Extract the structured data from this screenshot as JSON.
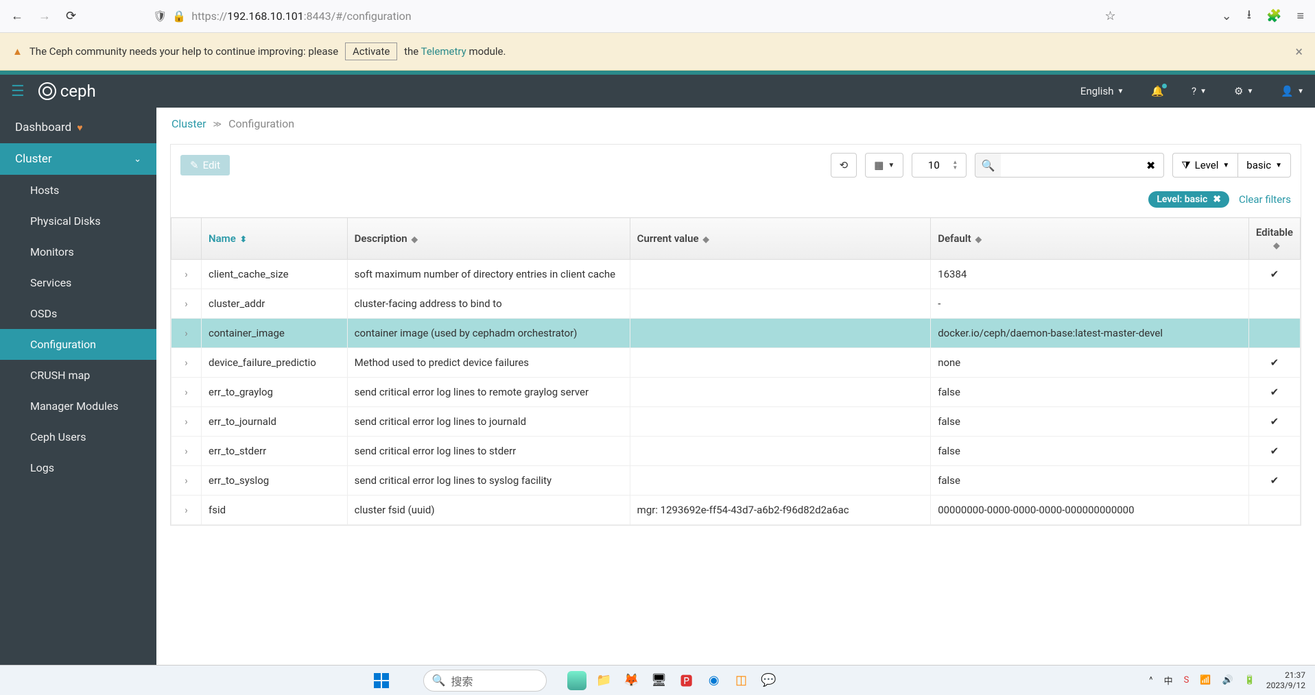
{
  "browser": {
    "url_scheme": "https://",
    "url_host": "192.168.10.101",
    "url_port": ":8443",
    "url_path": "/#/configuration"
  },
  "banner": {
    "text_before": "The Ceph community needs your help to continue improving: please",
    "activate": "Activate",
    "text_mid": "the",
    "telemetry": "Telemetry",
    "text_after": "module."
  },
  "topnav": {
    "brand": "ceph",
    "language": "English"
  },
  "sidebar": {
    "dashboard": "Dashboard",
    "cluster": "Cluster",
    "items": [
      "Hosts",
      "Physical Disks",
      "Monitors",
      "Services",
      "OSDs",
      "Configuration",
      "CRUSH map",
      "Manager Modules",
      "Ceph Users",
      "Logs"
    ]
  },
  "breadcrumb": {
    "root": "Cluster",
    "current": "Configuration"
  },
  "toolbar": {
    "edit": "Edit",
    "page_size": "10",
    "level_label": "Level",
    "level_value": "basic"
  },
  "filters": {
    "chip": "Level: basic",
    "clear": "Clear filters"
  },
  "table": {
    "headers": {
      "name": "Name",
      "description": "Description",
      "current_value": "Current value",
      "default": "Default",
      "editable": "Editable"
    },
    "rows": [
      {
        "name": "client_cache_size",
        "description": "soft maximum number of directory entries in client cache",
        "current": "",
        "default": "16384",
        "editable": true,
        "highlight": false
      },
      {
        "name": "cluster_addr",
        "description": "cluster-facing address to bind to",
        "current": "",
        "default": "-",
        "editable": false,
        "highlight": false
      },
      {
        "name": "container_image",
        "description": "container image (used by cephadm orchestrator)",
        "current": "",
        "default": "docker.io/ceph/daemon-base:latest-master-devel",
        "editable": false,
        "highlight": true
      },
      {
        "name": "device_failure_predictio",
        "description": "Method used to predict device failures",
        "current": "",
        "default": "none",
        "editable": true,
        "highlight": false
      },
      {
        "name": "err_to_graylog",
        "description": "send critical error log lines to remote graylog server",
        "current": "",
        "default": "false",
        "editable": true,
        "highlight": false
      },
      {
        "name": "err_to_journald",
        "description": "send critical error log lines to journald",
        "current": "",
        "default": "false",
        "editable": true,
        "highlight": false
      },
      {
        "name": "err_to_stderr",
        "description": "send critical error log lines to stderr",
        "current": "",
        "default": "false",
        "editable": true,
        "highlight": false
      },
      {
        "name": "err_to_syslog",
        "description": "send critical error log lines to syslog facility",
        "current": "",
        "default": "false",
        "editable": true,
        "highlight": false
      },
      {
        "name": "fsid",
        "description": "cluster fsid (uuid)",
        "current": "mgr: 1293692e-ff54-43d7-a6b2-f96d82d2a6ac",
        "default": "00000000-0000-0000-0000-000000000000",
        "editable": false,
        "highlight": false
      }
    ]
  },
  "taskbar": {
    "search": "搜索",
    "ime": "中",
    "time": "21:37",
    "date": "2023/9/12"
  }
}
